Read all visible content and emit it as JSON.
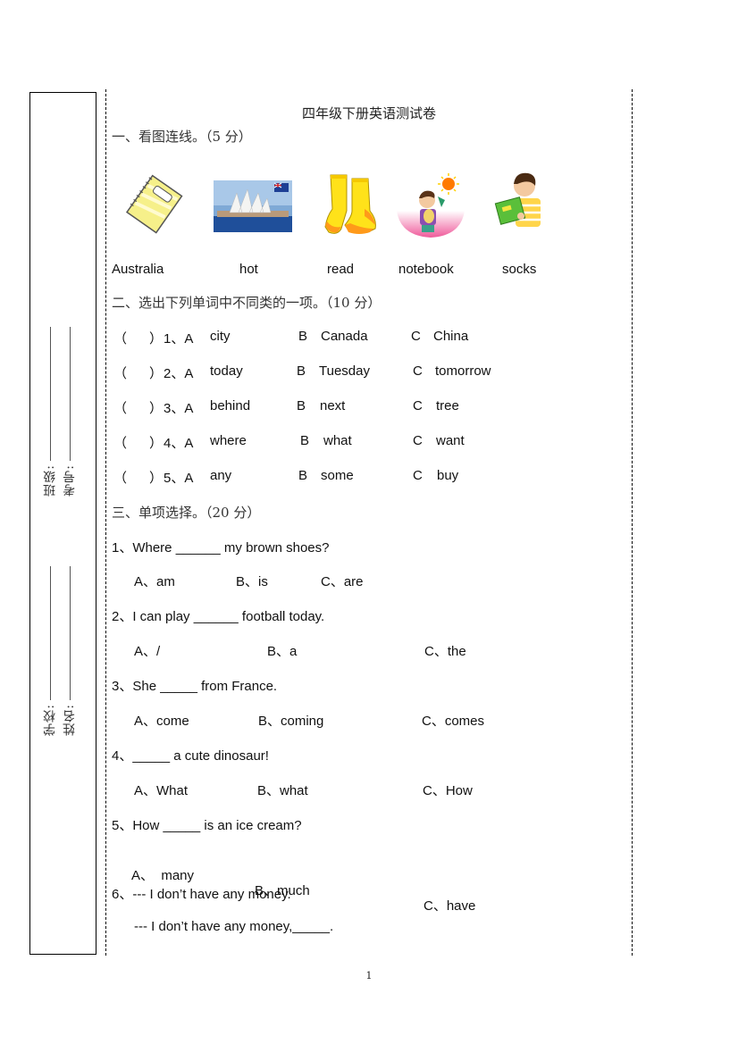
{
  "title": "四年级下册英语测试卷",
  "binding": {
    "fields": [
      {
        "label": "班级:"
      },
      {
        "label": "考号:"
      },
      {
        "label": "学校:"
      },
      {
        "label": "姓名:"
      }
    ]
  },
  "section1": {
    "heading": "一、看图连线。（5 分）",
    "pictures": [
      {
        "icon": "notebook-picture"
      },
      {
        "icon": "sydney-opera-house-picture"
      },
      {
        "icon": "socks-picture"
      },
      {
        "icon": "hot-boy-picture"
      },
      {
        "icon": "reading-boy-picture"
      }
    ],
    "words": [
      "Australia",
      "hot",
      "read",
      "notebook",
      "socks"
    ]
  },
  "section2": {
    "heading": "二、选出下列单词中不同类的一项。（10 分）",
    "items": [
      {
        "paren": "（",
        "paren_close": "）",
        "num": "1、A",
        "a": "city",
        "b_label": "B",
        "b": "Canada",
        "c_label": "C",
        "c": "China"
      },
      {
        "paren": "（",
        "paren_close": "）",
        "num": "2、A",
        "a": "today",
        "b_label": "B",
        "b": "Tuesday",
        "c_label": "C",
        "c": "tomorrow"
      },
      {
        "paren": "（",
        "paren_close": "）",
        "num": "3、A",
        "a": "behind",
        "b_label": "B",
        "b": "next",
        "c_label": "C",
        "c": "tree"
      },
      {
        "paren": "（",
        "paren_close": "）",
        "num": "4、A",
        "a": "where",
        "b_label": "B",
        "b": "what",
        "c_label": "C",
        "c": "want"
      },
      {
        "paren": "（",
        "paren_close": "）",
        "num": "5、A",
        "a": "any",
        "b_label": "B",
        "b": "some",
        "c_label": "C",
        "c": "buy"
      }
    ]
  },
  "section3": {
    "heading": "三、单项选择。（20 分）",
    "questions": [
      {
        "text": "1、Where ______ my brown shoes?",
        "a": "A、am",
        "b": "B、is",
        "c": "C、are"
      },
      {
        "text": "2、I can play ______ football today.",
        "a": "A、/",
        "b": "B、a",
        "c": "C、the"
      },
      {
        "text": "3、She _____ from France.",
        "a": "A、come",
        "b": "B、coming",
        "c": "C、comes"
      },
      {
        "text": "4、_____ a cute dinosaur!",
        "a": "A、What",
        "b": "B、what",
        "c": "C、How"
      },
      {
        "text": "5、How _____ is an ice cream?",
        "a": "A、  many",
        "b": "B、much",
        "c": "C、have"
      },
      {
        "text": "6、--- I don’t have any money.",
        "line2": "--- I don’t have any money,_____."
      }
    ]
  },
  "page_number": "1"
}
